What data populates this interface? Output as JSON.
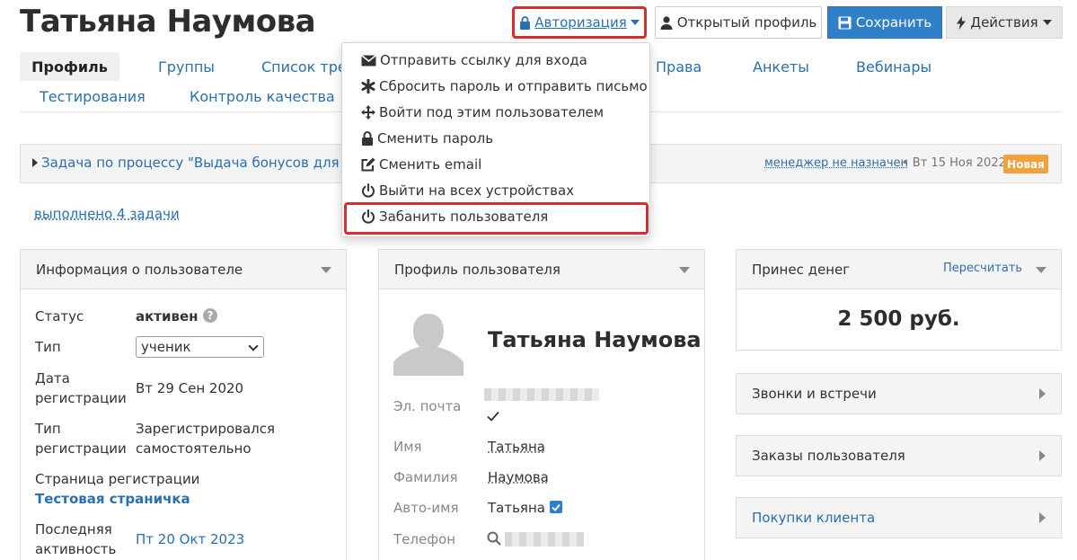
{
  "header": {
    "user_name": "Татьяна Наумова",
    "auth_button": "Авторизация",
    "open_profile_button": "Открытый профиль",
    "save_button": "Сохранить",
    "actions_button": "Действия"
  },
  "tabs": {
    "row1": [
      "Профиль",
      "Группы",
      "Список тре",
      "Права",
      "Анкеты",
      "Вебинары"
    ],
    "row2": [
      "Тестирования",
      "Контроль качества"
    ]
  },
  "task": {
    "text": "Задача по процессу \"Выдача бонусов для нов",
    "manager": "менеджер не назначен",
    "date": "• Вт 15 Ноя 2022",
    "badge": "Новая",
    "done_link": "выполнено 4 задачи",
    "badge_color": "#f0a33c"
  },
  "auth_menu": {
    "items": [
      {
        "label": "Отправить ссылку для входа",
        "icon": "envelope-icon"
      },
      {
        "label": "Сбросить пароль и отправить письмо",
        "icon": "asterisk-icon"
      },
      {
        "label": "Войти под этим пользователем",
        "icon": "move-icon"
      },
      {
        "label": "Сменить пароль",
        "icon": "lock-icon"
      },
      {
        "label": "Сменить email",
        "icon": "edit-icon"
      },
      {
        "label": "Выйти на всех устройствах",
        "icon": "power-icon"
      },
      {
        "label": "Забанить пользователя",
        "icon": "power-icon"
      }
    ]
  },
  "info_panel": {
    "title": "Информация о пользователе",
    "status_label": "Статус",
    "status_value": "активен",
    "type_label": "Тип",
    "type_value": "ученик",
    "reg_date_label_1": "Дата",
    "reg_date_label_2": "регистрации",
    "reg_date_value": "Вт 29 Сен 2020",
    "reg_type_label_1": "Тип",
    "reg_type_label_2": "регистрации",
    "reg_type_value_1": "Зарегистрировался",
    "reg_type_value_2": "самостоятельно",
    "reg_page_label": "Страница регистрации",
    "reg_page_value": "Тестовая страничка",
    "last_activity_label_1": "Последняя",
    "last_activity_label_2": "активность",
    "last_activity_value": "Пт 20 Окт 2023"
  },
  "profile_panel": {
    "title": "Профиль пользователя",
    "name": "Татьяна Наумова",
    "email_label": "Эл. почта",
    "first_name_label": "Имя",
    "first_name_value": "Татьяна",
    "last_name_label": "Фамилия",
    "last_name_value": "Наумова",
    "auto_name_label": "Авто-имя",
    "auto_name_value": "Татьяна",
    "phone_label": "Телефон"
  },
  "money_panel": {
    "title": "Принес денег",
    "recalc": "Пересчитать",
    "amount": "2 500 руб."
  },
  "side_panels": {
    "calls": "Звонки и встречи",
    "orders": "Заказы пользователя",
    "purchases": "Покупки клиента"
  },
  "colors": {
    "accent": "#2f80c8",
    "link": "#2a6fb0",
    "highlight": "#d82e2e"
  }
}
